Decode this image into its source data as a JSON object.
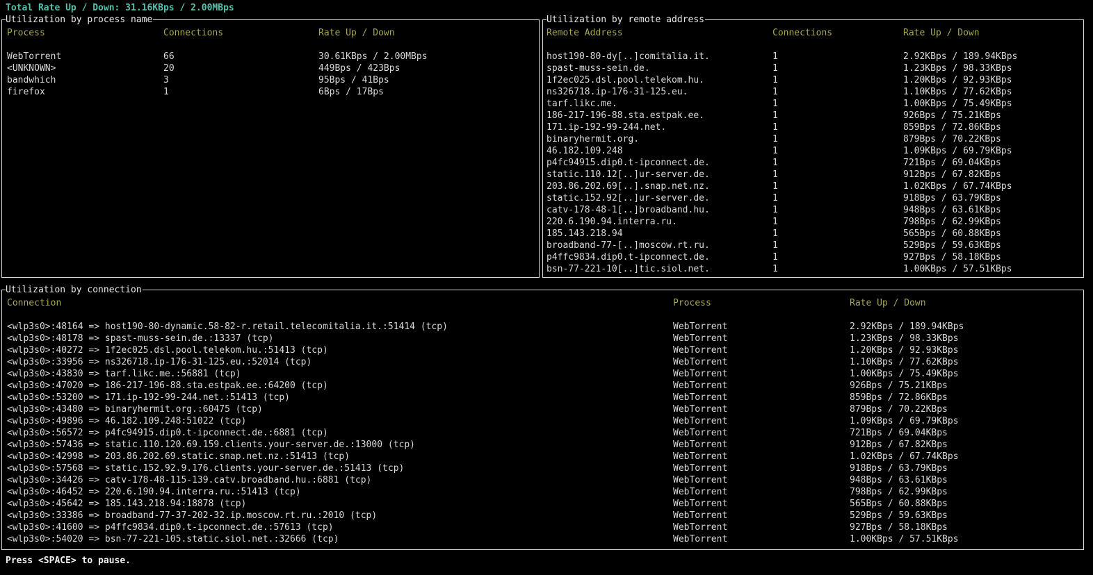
{
  "colors": {
    "background": "#000000",
    "accent_cyan": "#56c2ad",
    "header_olive": "#a7a750",
    "border_white": "#dcdcdc",
    "text": "#d8d8d8"
  },
  "total_line": "Total Rate Up / Down: 31.16KBps / 2.00MBps",
  "footer": "Press <SPACE> to pause.",
  "process_panel": {
    "title": "Utilization by process name",
    "columns": {
      "process": "Process",
      "connections": "Connections",
      "rate": "Rate Up / Down"
    },
    "rows": [
      {
        "process": "WebTorrent",
        "connections": "66",
        "rate": "30.61KBps / 2.00MBps"
      },
      {
        "process": "<UNKNOWN>",
        "connections": "20",
        "rate": "449Bps / 423Bps"
      },
      {
        "process": "bandwhich",
        "connections": "3",
        "rate": "95Bps / 41Bps"
      },
      {
        "process": "firefox",
        "connections": "1",
        "rate": "6Bps / 17Bps"
      }
    ]
  },
  "remote_panel": {
    "title": "Utilization by remote address",
    "columns": {
      "address": "Remote Address",
      "connections": "Connections",
      "rate": "Rate Up / Down"
    },
    "rows": [
      {
        "address": "host190-80-dy[..]comitalia.it.",
        "connections": "1",
        "rate": "2.92KBps / 189.94KBps"
      },
      {
        "address": "spast-muss-sein.de.",
        "connections": "1",
        "rate": "1.23KBps / 98.33KBps"
      },
      {
        "address": "1f2ec025.dsl.pool.telekom.hu.",
        "connections": "1",
        "rate": "1.20KBps / 92.93KBps"
      },
      {
        "address": "ns326718.ip-176-31-125.eu.",
        "connections": "1",
        "rate": "1.10KBps / 77.62KBps"
      },
      {
        "address": "tarf.likc.me.",
        "connections": "1",
        "rate": "1.00KBps / 75.49KBps"
      },
      {
        "address": "186-217-196-88.sta.estpak.ee.",
        "connections": "1",
        "rate": "926Bps / 75.21KBps"
      },
      {
        "address": "171.ip-192-99-244.net.",
        "connections": "1",
        "rate": "859Bps / 72.86KBps"
      },
      {
        "address": "binaryhermit.org.",
        "connections": "1",
        "rate": "879Bps / 70.22KBps"
      },
      {
        "address": "46.182.109.248",
        "connections": "1",
        "rate": "1.09KBps / 69.79KBps"
      },
      {
        "address": "p4fc94915.dip0.t-ipconnect.de.",
        "connections": "1",
        "rate": "721Bps / 69.04KBps"
      },
      {
        "address": "static.110.12[..]ur-server.de.",
        "connections": "1",
        "rate": "912Bps / 67.82KBps"
      },
      {
        "address": "203.86.202.69[..].snap.net.nz.",
        "connections": "1",
        "rate": "1.02KBps / 67.74KBps"
      },
      {
        "address": "static.152.92[..]ur-server.de.",
        "connections": "1",
        "rate": "918Bps / 63.79KBps"
      },
      {
        "address": "catv-178-48-1[..]broadband.hu.",
        "connections": "1",
        "rate": "948Bps / 63.61KBps"
      },
      {
        "address": "220.6.190.94.interra.ru.",
        "connections": "1",
        "rate": "798Bps / 62.99KBps"
      },
      {
        "address": "185.143.218.94",
        "connections": "1",
        "rate": "565Bps / 60.88KBps"
      },
      {
        "address": "broadband-77-[..]moscow.rt.ru.",
        "connections": "1",
        "rate": "529Bps / 59.63KBps"
      },
      {
        "address": "p4ffc9834.dip0.t-ipconnect.de.",
        "connections": "1",
        "rate": "927Bps / 58.18KBps"
      },
      {
        "address": "bsn-77-221-10[..]tic.siol.net.",
        "connections": "1",
        "rate": "1.00KBps / 57.51KBps"
      }
    ]
  },
  "connection_panel": {
    "title": "Utilization by connection",
    "columns": {
      "connection": "Connection",
      "process": "Process",
      "rate": "Rate Up / Down"
    },
    "rows": [
      {
        "connection": "<wlp3s0>:48164 => host190-80-dynamic.58-82-r.retail.telecomitalia.it.:51414 (tcp)",
        "process": "WebTorrent",
        "rate": "2.92KBps / 189.94KBps"
      },
      {
        "connection": "<wlp3s0>:48178 => spast-muss-sein.de.:13337 (tcp)",
        "process": "WebTorrent",
        "rate": "1.23KBps / 98.33KBps"
      },
      {
        "connection": "<wlp3s0>:40272 => 1f2ec025.dsl.pool.telekom.hu.:51413 (tcp)",
        "process": "WebTorrent",
        "rate": "1.20KBps / 92.93KBps"
      },
      {
        "connection": "<wlp3s0>:33956 => ns326718.ip-176-31-125.eu.:52014 (tcp)",
        "process": "WebTorrent",
        "rate": "1.10KBps / 77.62KBps"
      },
      {
        "connection": "<wlp3s0>:43830 => tarf.likc.me.:56881 (tcp)",
        "process": "WebTorrent",
        "rate": "1.00KBps / 75.49KBps"
      },
      {
        "connection": "<wlp3s0>:47020 => 186-217-196-88.sta.estpak.ee.:64200 (tcp)",
        "process": "WebTorrent",
        "rate": "926Bps / 75.21KBps"
      },
      {
        "connection": "<wlp3s0>:53200 => 171.ip-192-99-244.net.:51413 (tcp)",
        "process": "WebTorrent",
        "rate": "859Bps / 72.86KBps"
      },
      {
        "connection": "<wlp3s0>:43480 => binaryhermit.org.:60475 (tcp)",
        "process": "WebTorrent",
        "rate": "879Bps / 70.22KBps"
      },
      {
        "connection": "<wlp3s0>:49896 => 46.182.109.248:51022 (tcp)",
        "process": "WebTorrent",
        "rate": "1.09KBps / 69.79KBps"
      },
      {
        "connection": "<wlp3s0>:56572 => p4fc94915.dip0.t-ipconnect.de.:6881 (tcp)",
        "process": "WebTorrent",
        "rate": "721Bps / 69.04KBps"
      },
      {
        "connection": "<wlp3s0>:57436 => static.110.120.69.159.clients.your-server.de.:13000 (tcp)",
        "process": "WebTorrent",
        "rate": "912Bps / 67.82KBps"
      },
      {
        "connection": "<wlp3s0>:42998 => 203.86.202.69.static.snap.net.nz.:51413 (tcp)",
        "process": "WebTorrent",
        "rate": "1.02KBps / 67.74KBps"
      },
      {
        "connection": "<wlp3s0>:57568 => static.152.92.9.176.clients.your-server.de.:51413 (tcp)",
        "process": "WebTorrent",
        "rate": "918Bps / 63.79KBps"
      },
      {
        "connection": "<wlp3s0>:34426 => catv-178-48-115-139.catv.broadband.hu.:6881 (tcp)",
        "process": "WebTorrent",
        "rate": "948Bps / 63.61KBps"
      },
      {
        "connection": "<wlp3s0>:46452 => 220.6.190.94.interra.ru.:51413 (tcp)",
        "process": "WebTorrent",
        "rate": "798Bps / 62.99KBps"
      },
      {
        "connection": "<wlp3s0>:45642 => 185.143.218.94:18878 (tcp)",
        "process": "WebTorrent",
        "rate": "565Bps / 60.88KBps"
      },
      {
        "connection": "<wlp3s0>:33386 => broadband-77-37-202-32.ip.moscow.rt.ru.:2010 (tcp)",
        "process": "WebTorrent",
        "rate": "529Bps / 59.63KBps"
      },
      {
        "connection": "<wlp3s0>:41600 => p4ffc9834.dip0.t-ipconnect.de.:57613 (tcp)",
        "process": "WebTorrent",
        "rate": "927Bps / 58.18KBps"
      },
      {
        "connection": "<wlp3s0>:54020 => bsn-77-221-105.static.siol.net.:32666 (tcp)",
        "process": "WebTorrent",
        "rate": "1.00KBps / 57.51KBps"
      }
    ]
  }
}
